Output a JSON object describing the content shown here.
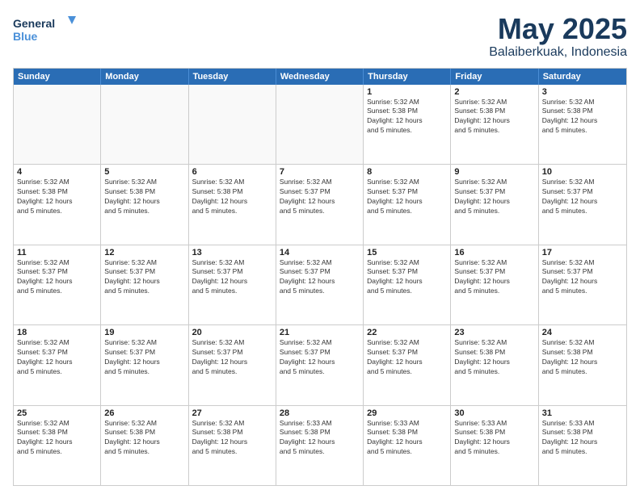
{
  "logo": {
    "line1": "General",
    "line2": "Blue"
  },
  "title": "May 2025",
  "subtitle": "Balaiberkuak, Indonesia",
  "days": [
    "Sunday",
    "Monday",
    "Tuesday",
    "Wednesday",
    "Thursday",
    "Friday",
    "Saturday"
  ],
  "weeks": [
    [
      {
        "num": "",
        "info": ""
      },
      {
        "num": "",
        "info": ""
      },
      {
        "num": "",
        "info": ""
      },
      {
        "num": "",
        "info": ""
      },
      {
        "num": "1",
        "info": "Sunrise: 5:32 AM\nSunset: 5:38 PM\nDaylight: 12 hours\nand 5 minutes."
      },
      {
        "num": "2",
        "info": "Sunrise: 5:32 AM\nSunset: 5:38 PM\nDaylight: 12 hours\nand 5 minutes."
      },
      {
        "num": "3",
        "info": "Sunrise: 5:32 AM\nSunset: 5:38 PM\nDaylight: 12 hours\nand 5 minutes."
      }
    ],
    [
      {
        "num": "4",
        "info": "Sunrise: 5:32 AM\nSunset: 5:38 PM\nDaylight: 12 hours\nand 5 minutes."
      },
      {
        "num": "5",
        "info": "Sunrise: 5:32 AM\nSunset: 5:38 PM\nDaylight: 12 hours\nand 5 minutes."
      },
      {
        "num": "6",
        "info": "Sunrise: 5:32 AM\nSunset: 5:38 PM\nDaylight: 12 hours\nand 5 minutes."
      },
      {
        "num": "7",
        "info": "Sunrise: 5:32 AM\nSunset: 5:37 PM\nDaylight: 12 hours\nand 5 minutes."
      },
      {
        "num": "8",
        "info": "Sunrise: 5:32 AM\nSunset: 5:37 PM\nDaylight: 12 hours\nand 5 minutes."
      },
      {
        "num": "9",
        "info": "Sunrise: 5:32 AM\nSunset: 5:37 PM\nDaylight: 12 hours\nand 5 minutes."
      },
      {
        "num": "10",
        "info": "Sunrise: 5:32 AM\nSunset: 5:37 PM\nDaylight: 12 hours\nand 5 minutes."
      }
    ],
    [
      {
        "num": "11",
        "info": "Sunrise: 5:32 AM\nSunset: 5:37 PM\nDaylight: 12 hours\nand 5 minutes."
      },
      {
        "num": "12",
        "info": "Sunrise: 5:32 AM\nSunset: 5:37 PM\nDaylight: 12 hours\nand 5 minutes."
      },
      {
        "num": "13",
        "info": "Sunrise: 5:32 AM\nSunset: 5:37 PM\nDaylight: 12 hours\nand 5 minutes."
      },
      {
        "num": "14",
        "info": "Sunrise: 5:32 AM\nSunset: 5:37 PM\nDaylight: 12 hours\nand 5 minutes."
      },
      {
        "num": "15",
        "info": "Sunrise: 5:32 AM\nSunset: 5:37 PM\nDaylight: 12 hours\nand 5 minutes."
      },
      {
        "num": "16",
        "info": "Sunrise: 5:32 AM\nSunset: 5:37 PM\nDaylight: 12 hours\nand 5 minutes."
      },
      {
        "num": "17",
        "info": "Sunrise: 5:32 AM\nSunset: 5:37 PM\nDaylight: 12 hours\nand 5 minutes."
      }
    ],
    [
      {
        "num": "18",
        "info": "Sunrise: 5:32 AM\nSunset: 5:37 PM\nDaylight: 12 hours\nand 5 minutes."
      },
      {
        "num": "19",
        "info": "Sunrise: 5:32 AM\nSunset: 5:37 PM\nDaylight: 12 hours\nand 5 minutes."
      },
      {
        "num": "20",
        "info": "Sunrise: 5:32 AM\nSunset: 5:37 PM\nDaylight: 12 hours\nand 5 minutes."
      },
      {
        "num": "21",
        "info": "Sunrise: 5:32 AM\nSunset: 5:37 PM\nDaylight: 12 hours\nand 5 minutes."
      },
      {
        "num": "22",
        "info": "Sunrise: 5:32 AM\nSunset: 5:37 PM\nDaylight: 12 hours\nand 5 minutes."
      },
      {
        "num": "23",
        "info": "Sunrise: 5:32 AM\nSunset: 5:38 PM\nDaylight: 12 hours\nand 5 minutes."
      },
      {
        "num": "24",
        "info": "Sunrise: 5:32 AM\nSunset: 5:38 PM\nDaylight: 12 hours\nand 5 minutes."
      }
    ],
    [
      {
        "num": "25",
        "info": "Sunrise: 5:32 AM\nSunset: 5:38 PM\nDaylight: 12 hours\nand 5 minutes."
      },
      {
        "num": "26",
        "info": "Sunrise: 5:32 AM\nSunset: 5:38 PM\nDaylight: 12 hours\nand 5 minutes."
      },
      {
        "num": "27",
        "info": "Sunrise: 5:32 AM\nSunset: 5:38 PM\nDaylight: 12 hours\nand 5 minutes."
      },
      {
        "num": "28",
        "info": "Sunrise: 5:33 AM\nSunset: 5:38 PM\nDaylight: 12 hours\nand 5 minutes."
      },
      {
        "num": "29",
        "info": "Sunrise: 5:33 AM\nSunset: 5:38 PM\nDaylight: 12 hours\nand 5 minutes."
      },
      {
        "num": "30",
        "info": "Sunrise: 5:33 AM\nSunset: 5:38 PM\nDaylight: 12 hours\nand 5 minutes."
      },
      {
        "num": "31",
        "info": "Sunrise: 5:33 AM\nSunset: 5:38 PM\nDaylight: 12 hours\nand 5 minutes."
      }
    ]
  ],
  "colors": {
    "header_bg": "#2a6db5",
    "header_text": "#ffffff",
    "title_color": "#1a3a5c"
  }
}
